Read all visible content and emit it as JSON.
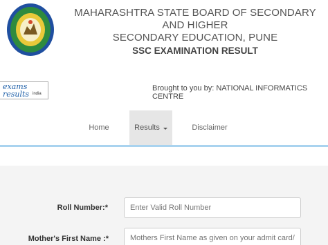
{
  "header": {
    "board_title_line1": "MAHARASHTRA STATE BOARD OF SECONDARY AND HIGHER",
    "board_title_line2": "SECONDARY EDUCATION, PUNE",
    "result_title": "SSC EXAMINATION RESULT"
  },
  "brand": {
    "logo_line1": "exams",
    "logo_line2": "results",
    "logo_suffix": "india",
    "brought_by": "Brought to you by: NATIONAL INFORMATICS CENTRE"
  },
  "nav": {
    "home": "Home",
    "results": "Results",
    "disclaimer": "Disclaimer"
  },
  "form": {
    "roll_label": "Roll Number:*",
    "roll_placeholder": "Enter Valid Roll Number",
    "mother_label": "Mother's First Name :*",
    "mother_placeholder": "Mothers First Name as given on your admit card/form"
  },
  "colors": {
    "nav_underline": "#a9d3ef",
    "active_tab_bg": "#e6e6e6",
    "seal_green": "#2e8b3e",
    "seal_blue": "#1f4fa0",
    "seal_yellow": "#e9c93a"
  },
  "icons": {
    "seal": "board-seal-icon",
    "caret": "caret-down-icon"
  }
}
